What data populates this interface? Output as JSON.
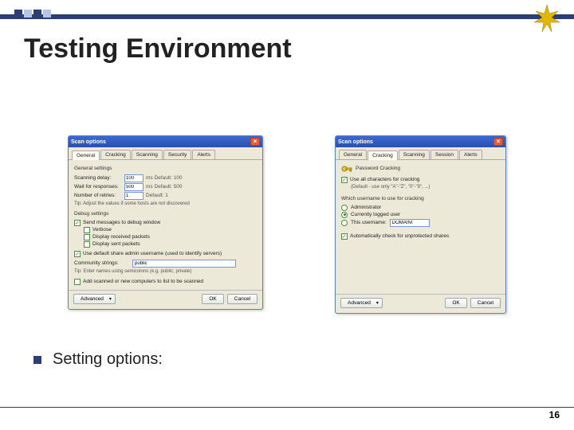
{
  "slide": {
    "title": "Testing Environment",
    "bullet": "Setting options:",
    "page": "16"
  },
  "dialog1": {
    "title": "Scan options",
    "close": "×",
    "tabs": [
      "General",
      "Cracking",
      "Scanning",
      "Security",
      "Alerts"
    ],
    "gs_title": "General settings",
    "scan_delay_label": "Scanning delay:",
    "scan_delay_value": "100",
    "scan_delay_hint": "ms   Default: 100",
    "wait_label": "Wait for responses:",
    "wait_value": "500",
    "wait_hint": "ms   Default: 500",
    "retries_label": "Number of retries:",
    "retries_value": "1",
    "retries_hint": "   Default: 1",
    "tip1": "Tip: Adjust the values if some hosts are not discovered",
    "debug_title": "Debug settings",
    "chk_send": "Send messages to debug window",
    "chk_verbose": "Verbose",
    "chk_display": "Display received packets",
    "chk_disp_sent": "Display sent packets",
    "chk_use_share": "Use default share admin username (used to identify servers)",
    "comm_label": "Community strings:",
    "comm_value": "public",
    "tip2": "Tip: Enter names using semicolons (e.g. public; private)",
    "chk_add": "Add scanned or new computers to list to be scanned",
    "btn_adv": "Advanced",
    "btn_ok": "OK",
    "btn_cancel": "Cancel"
  },
  "dialog2": {
    "title": "Scan options",
    "close": "×",
    "tabs": [
      "General",
      "Cracking",
      "Scanning",
      "Session",
      "Alerts"
    ],
    "pw_title": "Password Cracking",
    "chk_all": "Use all characters for cracking",
    "default_note": "(Default - use only \"A\"-\"Z\", \"0\"-\"9\", ...)",
    "which_user": "Which username to use for cracking",
    "r1": "Administrator",
    "r2": "Currently logged user",
    "r3": "This username:",
    "r3_value": "DOMAIN\\",
    "chk_auto": "Automatically check for unprotected shares",
    "btn_adv": "Advanced",
    "btn_ok": "OK",
    "btn_cancel": "Cancel"
  }
}
